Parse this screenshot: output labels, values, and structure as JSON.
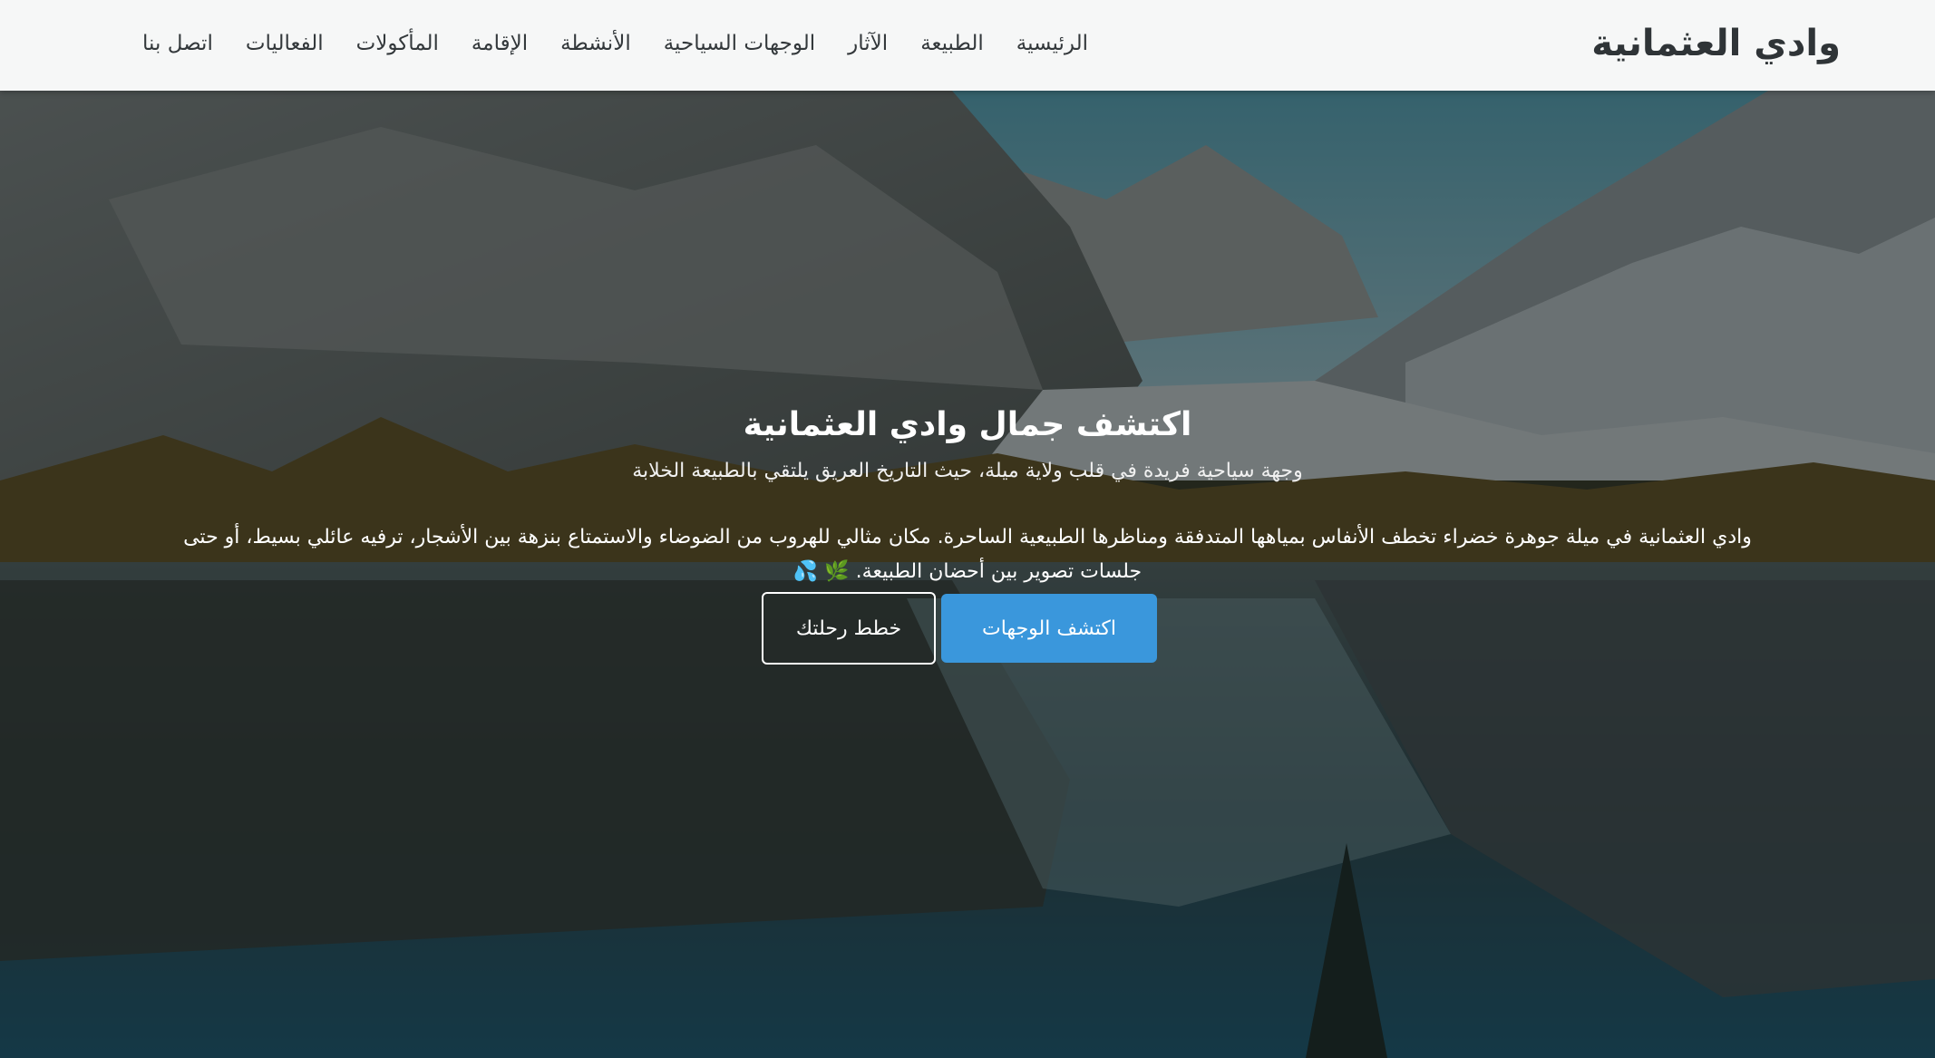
{
  "header": {
    "logo": "وادي العثمانية",
    "nav": [
      {
        "label": "الرئيسية"
      },
      {
        "label": "الطبيعة"
      },
      {
        "label": "الآثار"
      },
      {
        "label": "الوجهات السياحية"
      },
      {
        "label": "الأنشطة"
      },
      {
        "label": "الإقامة"
      },
      {
        "label": "المأكولات"
      },
      {
        "label": "الفعاليات"
      },
      {
        "label": "اتصل بنا"
      }
    ]
  },
  "hero": {
    "title": "اكتشف جمال وادي العثمانية",
    "subtitle": "وجهة سياحية فريدة في قلب ولاية ميلة، حيث التاريخ العريق يلتقي بالطبيعة الخلابة",
    "description": "وادي العثمانية في ميلة جوهرة خضراء تخطف الأنفاس بمياهها المتدفقة ومناظرها الطبيعية الساحرة. مكان مثالي للهروب من الضوضاء والاستمتاع بنزهة بين الأشجار، ترفيه عائلي بسيط، أو حتى جلسات تصوير بين أحضان الطبيعة.",
    "emoji": "🌿 💦",
    "primary_button": "اكتشف الوجهات",
    "secondary_button": "خطط رحلتك",
    "background_image": "mountain-lake-reflection"
  },
  "colors": {
    "header_bg": "#f6f7f7",
    "primary_button": "#3a97dc",
    "text_dark": "#2f3437",
    "text_light": "#ffffff"
  }
}
